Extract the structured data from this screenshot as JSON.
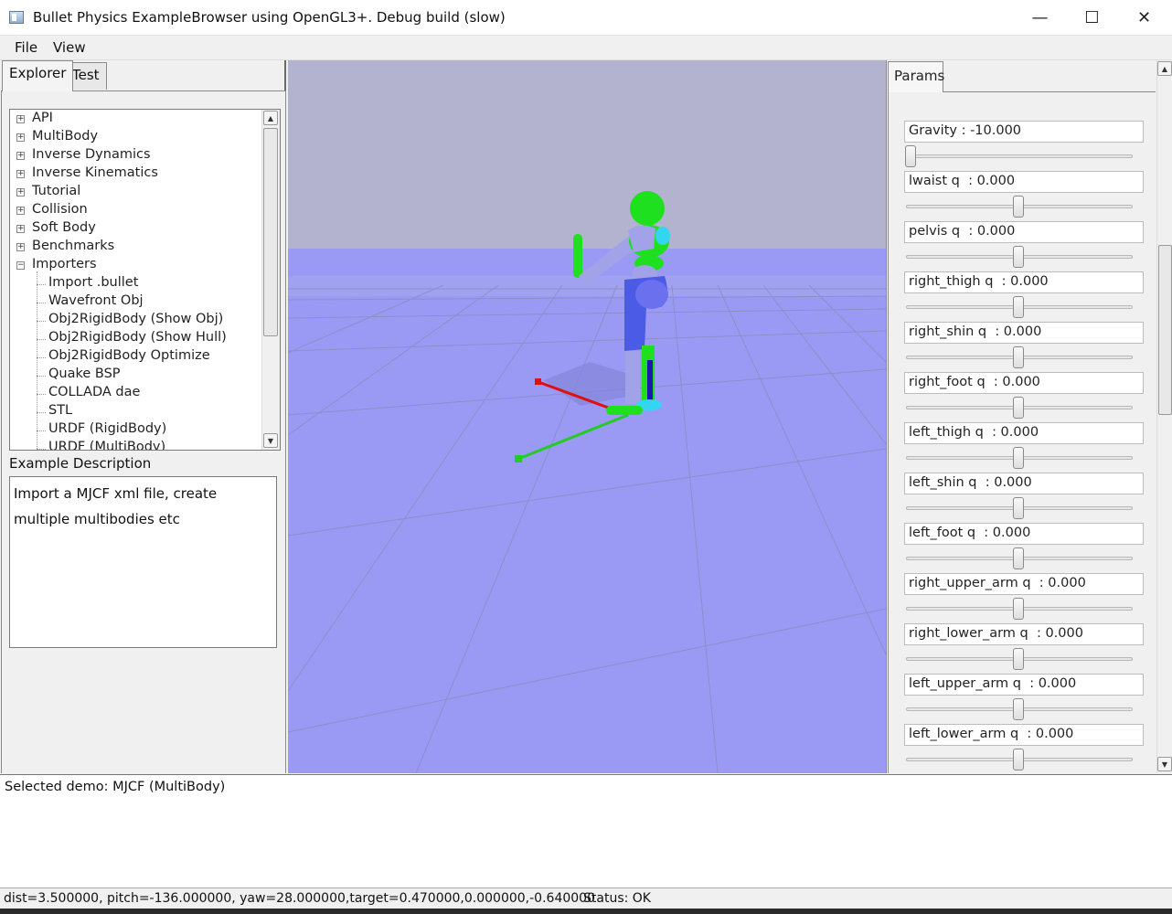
{
  "window": {
    "title": "Bullet Physics ExampleBrowser using OpenGL3+. Debug build (slow)",
    "minimize": "—",
    "maximize": "☐",
    "close": "✕"
  },
  "menu": {
    "file": "File",
    "view": "View"
  },
  "left_tabs": {
    "explorer": "Explorer",
    "test": "Test"
  },
  "tree": {
    "categories": [
      {
        "label": "API",
        "expanded": false
      },
      {
        "label": "MultiBody",
        "expanded": false
      },
      {
        "label": "Inverse Dynamics",
        "expanded": false
      },
      {
        "label": "Inverse Kinematics",
        "expanded": false
      },
      {
        "label": "Tutorial",
        "expanded": false
      },
      {
        "label": "Collision",
        "expanded": false
      },
      {
        "label": "Soft Body",
        "expanded": false
      },
      {
        "label": "Benchmarks",
        "expanded": false
      },
      {
        "label": "Importers",
        "expanded": true
      }
    ],
    "importers_children": [
      "Import .bullet",
      "Wavefront Obj",
      "Obj2RigidBody (Show Obj)",
      "Obj2RigidBody (Show Hull)",
      "Obj2RigidBody Optimize",
      "Quake BSP",
      "COLLADA dae",
      "STL",
      "URDF (RigidBody)",
      "URDF (MultiBody)"
    ],
    "plus_glyph": "+",
    "minus_glyph": "−"
  },
  "description": {
    "label": "Example Description",
    "line1": "Import a MJCF xml file, create",
    "line2": "multiple multibodies etc"
  },
  "params": {
    "tab": "Params",
    "items": [
      {
        "text": "Gravity : -10.000",
        "level": 0.0
      },
      {
        "text": "lwaist q  : 0.000",
        "level": 0.5
      },
      {
        "text": "pelvis q  : 0.000",
        "level": 0.5
      },
      {
        "text": "right_thigh q  : 0.000",
        "level": 0.5
      },
      {
        "text": "right_shin q  : 0.000",
        "level": 0.5
      },
      {
        "text": "right_foot q  : 0.000",
        "level": 0.5
      },
      {
        "text": "left_thigh q  : 0.000",
        "level": 0.5
      },
      {
        "text": "left_shin q  : 0.000",
        "level": 0.5
      },
      {
        "text": "left_foot q  : 0.000",
        "level": 0.5
      },
      {
        "text": "right_upper_arm q  : 0.000",
        "level": 0.5
      },
      {
        "text": "right_lower_arm q  : 0.000",
        "level": 0.5
      },
      {
        "text": "left_upper_arm q  : 0.000",
        "level": 0.5
      },
      {
        "text": "left_lower_arm q  : 0.000",
        "level": 0.5
      }
    ]
  },
  "console": {
    "text": "Selected demo: MJCF (MultiBody)"
  },
  "status": {
    "camera": "dist=3.500000, pitch=-136.000000, yaw=28.000000,target=0.470000,0.000000,-0.640000",
    "state": "Status: OK"
  },
  "scroll_glyphs": {
    "up": "▲",
    "down": "▼"
  },
  "colors": {
    "sky": "#b3b3cf",
    "floor": "#9a9af5",
    "body_blue": "#4b5be6",
    "limb_lavender": "#a2a2e8",
    "joint_green": "#1ee01e",
    "accent_cyan": "#33d6f0",
    "axis_red": "#e01010",
    "axis_green": "#22cc22"
  }
}
